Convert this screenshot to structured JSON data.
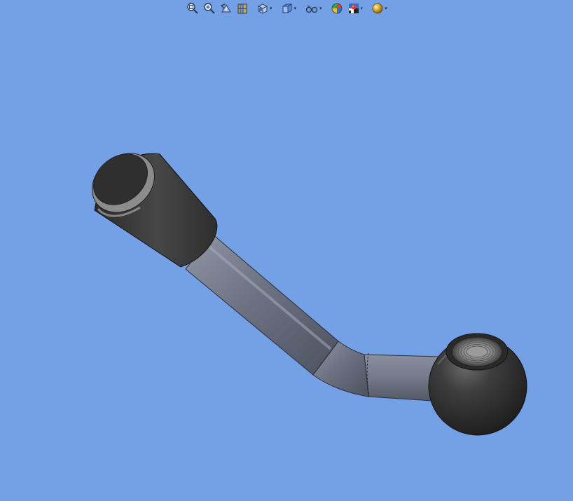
{
  "viewport": {
    "background_color": "#74a1e6",
    "part_color_dark": "#3d3d3d",
    "part_color_rod": "#6f7585"
  },
  "toolbar": {
    "items": [
      {
        "name": "zoom-to-fit",
        "icon": "zoom-to-fit-icon",
        "dropdown": false
      },
      {
        "name": "zoom-to-area",
        "icon": "zoom-to-area-icon",
        "dropdown": false
      },
      {
        "name": "previous-view",
        "icon": "previous-view-icon",
        "dropdown": false
      },
      {
        "name": "section-view",
        "icon": "section-view-icon",
        "dropdown": false
      },
      {
        "name": "view-orientation",
        "icon": "view-orientation-icon",
        "dropdown": true
      },
      {
        "name": "display-style",
        "icon": "display-style-icon",
        "dropdown": true
      },
      {
        "name": "hide-show-items",
        "icon": "hide-show-items-icon",
        "dropdown": true
      },
      {
        "name": "edit-appearance",
        "icon": "edit-appearance-icon",
        "dropdown": false
      },
      {
        "name": "apply-scene",
        "icon": "apply-scene-icon",
        "dropdown": true
      },
      {
        "name": "view-settings",
        "icon": "view-settings-icon",
        "dropdown": true
      }
    ]
  },
  "model": {
    "components": [
      "knob-grip",
      "crank-arm",
      "ball-hub",
      "threaded-bore"
    ]
  }
}
